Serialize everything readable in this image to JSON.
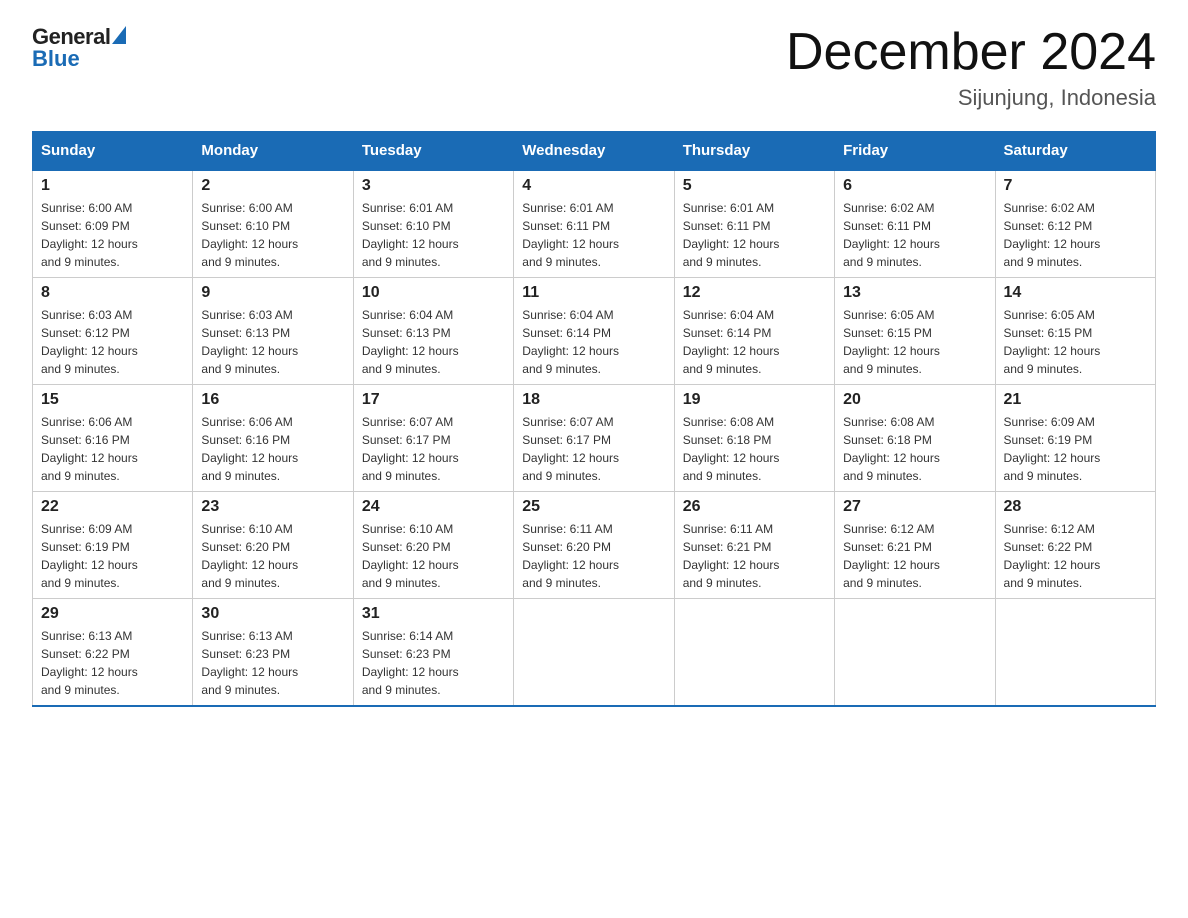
{
  "logo": {
    "general": "General",
    "blue": "Blue"
  },
  "title": "December 2024",
  "subtitle": "Sijunjung, Indonesia",
  "days_of_week": [
    "Sunday",
    "Monday",
    "Tuesday",
    "Wednesday",
    "Thursday",
    "Friday",
    "Saturday"
  ],
  "weeks": [
    [
      {
        "num": "1",
        "sunrise": "6:00 AM",
        "sunset": "6:09 PM",
        "daylight": "12 hours and 9 minutes."
      },
      {
        "num": "2",
        "sunrise": "6:00 AM",
        "sunset": "6:10 PM",
        "daylight": "12 hours and 9 minutes."
      },
      {
        "num": "3",
        "sunrise": "6:01 AM",
        "sunset": "6:10 PM",
        "daylight": "12 hours and 9 minutes."
      },
      {
        "num": "4",
        "sunrise": "6:01 AM",
        "sunset": "6:11 PM",
        "daylight": "12 hours and 9 minutes."
      },
      {
        "num": "5",
        "sunrise": "6:01 AM",
        "sunset": "6:11 PM",
        "daylight": "12 hours and 9 minutes."
      },
      {
        "num": "6",
        "sunrise": "6:02 AM",
        "sunset": "6:11 PM",
        "daylight": "12 hours and 9 minutes."
      },
      {
        "num": "7",
        "sunrise": "6:02 AM",
        "sunset": "6:12 PM",
        "daylight": "12 hours and 9 minutes."
      }
    ],
    [
      {
        "num": "8",
        "sunrise": "6:03 AM",
        "sunset": "6:12 PM",
        "daylight": "12 hours and 9 minutes."
      },
      {
        "num": "9",
        "sunrise": "6:03 AM",
        "sunset": "6:13 PM",
        "daylight": "12 hours and 9 minutes."
      },
      {
        "num": "10",
        "sunrise": "6:04 AM",
        "sunset": "6:13 PM",
        "daylight": "12 hours and 9 minutes."
      },
      {
        "num": "11",
        "sunrise": "6:04 AM",
        "sunset": "6:14 PM",
        "daylight": "12 hours and 9 minutes."
      },
      {
        "num": "12",
        "sunrise": "6:04 AM",
        "sunset": "6:14 PM",
        "daylight": "12 hours and 9 minutes."
      },
      {
        "num": "13",
        "sunrise": "6:05 AM",
        "sunset": "6:15 PM",
        "daylight": "12 hours and 9 minutes."
      },
      {
        "num": "14",
        "sunrise": "6:05 AM",
        "sunset": "6:15 PM",
        "daylight": "12 hours and 9 minutes."
      }
    ],
    [
      {
        "num": "15",
        "sunrise": "6:06 AM",
        "sunset": "6:16 PM",
        "daylight": "12 hours and 9 minutes."
      },
      {
        "num": "16",
        "sunrise": "6:06 AM",
        "sunset": "6:16 PM",
        "daylight": "12 hours and 9 minutes."
      },
      {
        "num": "17",
        "sunrise": "6:07 AM",
        "sunset": "6:17 PM",
        "daylight": "12 hours and 9 minutes."
      },
      {
        "num": "18",
        "sunrise": "6:07 AM",
        "sunset": "6:17 PM",
        "daylight": "12 hours and 9 minutes."
      },
      {
        "num": "19",
        "sunrise": "6:08 AM",
        "sunset": "6:18 PM",
        "daylight": "12 hours and 9 minutes."
      },
      {
        "num": "20",
        "sunrise": "6:08 AM",
        "sunset": "6:18 PM",
        "daylight": "12 hours and 9 minutes."
      },
      {
        "num": "21",
        "sunrise": "6:09 AM",
        "sunset": "6:19 PM",
        "daylight": "12 hours and 9 minutes."
      }
    ],
    [
      {
        "num": "22",
        "sunrise": "6:09 AM",
        "sunset": "6:19 PM",
        "daylight": "12 hours and 9 minutes."
      },
      {
        "num": "23",
        "sunrise": "6:10 AM",
        "sunset": "6:20 PM",
        "daylight": "12 hours and 9 minutes."
      },
      {
        "num": "24",
        "sunrise": "6:10 AM",
        "sunset": "6:20 PM",
        "daylight": "12 hours and 9 minutes."
      },
      {
        "num": "25",
        "sunrise": "6:11 AM",
        "sunset": "6:20 PM",
        "daylight": "12 hours and 9 minutes."
      },
      {
        "num": "26",
        "sunrise": "6:11 AM",
        "sunset": "6:21 PM",
        "daylight": "12 hours and 9 minutes."
      },
      {
        "num": "27",
        "sunrise": "6:12 AM",
        "sunset": "6:21 PM",
        "daylight": "12 hours and 9 minutes."
      },
      {
        "num": "28",
        "sunrise": "6:12 AM",
        "sunset": "6:22 PM",
        "daylight": "12 hours and 9 minutes."
      }
    ],
    [
      {
        "num": "29",
        "sunrise": "6:13 AM",
        "sunset": "6:22 PM",
        "daylight": "12 hours and 9 minutes."
      },
      {
        "num": "30",
        "sunrise": "6:13 AM",
        "sunset": "6:23 PM",
        "daylight": "12 hours and 9 minutes."
      },
      {
        "num": "31",
        "sunrise": "6:14 AM",
        "sunset": "6:23 PM",
        "daylight": "12 hours and 9 minutes."
      },
      null,
      null,
      null,
      null
    ]
  ]
}
